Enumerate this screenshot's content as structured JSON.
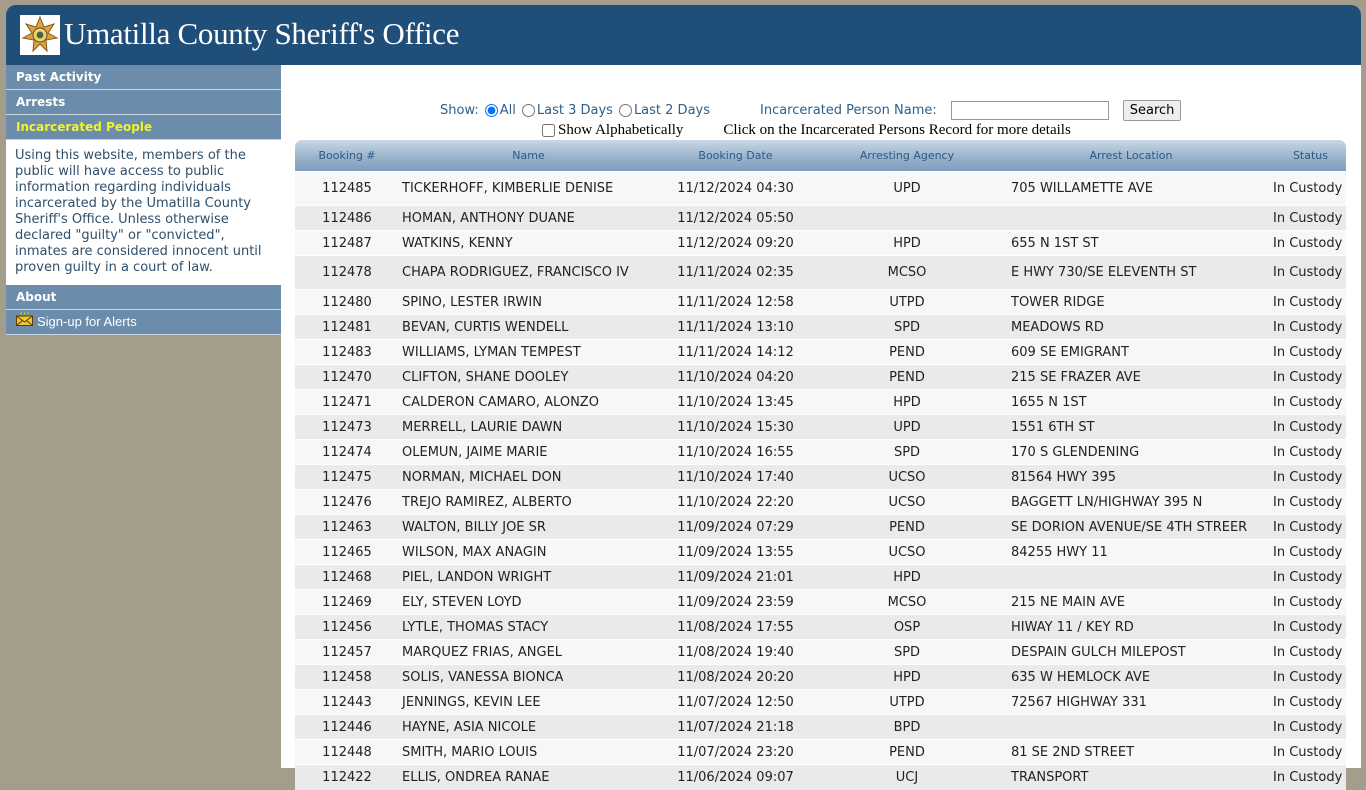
{
  "header": {
    "title": "Umatilla County Sheriff's Office",
    "logo_icon": "sheriff-star-badge-icon"
  },
  "sidebar": {
    "items": [
      {
        "label": "Past Activity",
        "active": false
      },
      {
        "label": "Arrests",
        "active": false
      },
      {
        "label": "Incarcerated People",
        "active": true
      }
    ],
    "disclaimer": "Using this website, members of the public will have access to public information regarding individuals incarcerated by the Umatilla County Sheriff's Office. Unless otherwise declared \"guilty\" or \"convicted\", inmates are considered innocent until proven guilty in a court of law.",
    "about_label": "About",
    "alerts_label": "Sign-up for Alerts",
    "alerts_icon": "envelope-icon"
  },
  "controls": {
    "show_label": "Show:",
    "options": [
      {
        "label": "All",
        "selected": true
      },
      {
        "label": "Last 3 Days",
        "selected": false
      },
      {
        "label": "Last 2 Days",
        "selected": false
      }
    ],
    "name_label": "Incarcerated Person Name:",
    "name_value": "",
    "search_label": "Search",
    "alpha_label": "Show Alphabetically",
    "alpha_checked": false,
    "note": "Click on the Incarcerated Persons Record for more details"
  },
  "table": {
    "headers": [
      "Booking #",
      "Name",
      "Booking Date",
      "Arresting Agency",
      "Arrest Location",
      "Status"
    ],
    "rows": [
      [
        "112485",
        "TICKERHOFF, KIMBERLIE DENISE",
        "11/12/2024 04:30",
        "UPD",
        "705 WILLAMETTE AVE",
        "In Custody"
      ],
      [
        "112486",
        "HOMAN, ANTHONY DUANE",
        "11/12/2024 05:50",
        "",
        "",
        "In Custody"
      ],
      [
        "112487",
        "WATKINS, KENNY",
        "11/12/2024 09:20",
        "HPD",
        "655 N 1ST ST",
        "In Custody"
      ],
      [
        "112478",
        "CHAPA RODRIGUEZ, FRANCISCO IV",
        "11/11/2024 02:35",
        "MCSO",
        "E HWY 730/SE ELEVENTH ST",
        "In Custody"
      ],
      [
        "112480",
        "SPINO, LESTER IRWIN",
        "11/11/2024 12:58",
        "UTPD",
        "TOWER RIDGE",
        "In Custody"
      ],
      [
        "112481",
        "BEVAN, CURTIS WENDELL",
        "11/11/2024 13:10",
        "SPD",
        "MEADOWS RD",
        "In Custody"
      ],
      [
        "112483",
        "WILLIAMS, LYMAN TEMPEST",
        "11/11/2024 14:12",
        "PEND",
        "609 SE EMIGRANT",
        "In Custody"
      ],
      [
        "112470",
        "CLIFTON, SHANE DOOLEY",
        "11/10/2024 04:20",
        "PEND",
        "215 SE FRAZER AVE",
        "In Custody"
      ],
      [
        "112471",
        "CALDERON CAMARO, ALONZO",
        "11/10/2024 13:45",
        "HPD",
        "1655 N 1ST",
        "In Custody"
      ],
      [
        "112473",
        "MERRELL, LAURIE DAWN",
        "11/10/2024 15:30",
        "UPD",
        "1551 6TH ST",
        "In Custody"
      ],
      [
        "112474",
        "OLEMUN, JAIME MARIE",
        "11/10/2024 16:55",
        "SPD",
        "170 S GLENDENING",
        "In Custody"
      ],
      [
        "112475",
        "NORMAN, MICHAEL DON",
        "11/10/2024 17:40",
        "UCSO",
        "81564 HWY 395",
        "In Custody"
      ],
      [
        "112476",
        "TREJO RAMIREZ, ALBERTO",
        "11/10/2024 22:20",
        "UCSO",
        "BAGGETT LN/HIGHWAY 395 N",
        "In Custody"
      ],
      [
        "112463",
        "WALTON, BILLY JOE SR",
        "11/09/2024 07:29",
        "PEND",
        "SE DORION AVENUE/SE 4TH STREER",
        "In Custody"
      ],
      [
        "112465",
        "WILSON, MAX ANAGIN",
        "11/09/2024 13:55",
        "UCSO",
        "84255 HWY 11",
        "In Custody"
      ],
      [
        "112468",
        "PIEL, LANDON WRIGHT",
        "11/09/2024 21:01",
        "HPD",
        "",
        "In Custody"
      ],
      [
        "112469",
        "ELY, STEVEN LOYD",
        "11/09/2024 23:59",
        "MCSO",
        "215 NE MAIN AVE",
        "In Custody"
      ],
      [
        "112456",
        "LYTLE, THOMAS STACY",
        "11/08/2024 17:55",
        "OSP",
        "HIWAY 11 / KEY RD",
        "In Custody"
      ],
      [
        "112457",
        "MARQUEZ FRIAS, ANGEL",
        "11/08/2024 19:40",
        "SPD",
        "DESPAIN GULCH MILEPOST",
        "In Custody"
      ],
      [
        "112458",
        "SOLIS, VANESSA BIONCA",
        "11/08/2024 20:20",
        "HPD",
        "635 W HEMLOCK AVE",
        "In Custody"
      ],
      [
        "112443",
        "JENNINGS, KEVIN LEE",
        "11/07/2024 12:50",
        "UTPD",
        "72567 HIGHWAY 331",
        "In Custody"
      ],
      [
        "112446",
        "HAYNE, ASIA NICOLE",
        "11/07/2024 21:18",
        "BPD",
        "",
        "In Custody"
      ],
      [
        "112448",
        "SMITH, MARIO LOUIS",
        "11/07/2024 23:20",
        "PEND",
        "81 SE 2ND STREET",
        "In Custody"
      ],
      [
        "112422",
        "ELLIS, ONDREA RANAE",
        "11/06/2024 09:07",
        "UCJ",
        "TRANSPORT",
        "In Custody"
      ]
    ]
  }
}
